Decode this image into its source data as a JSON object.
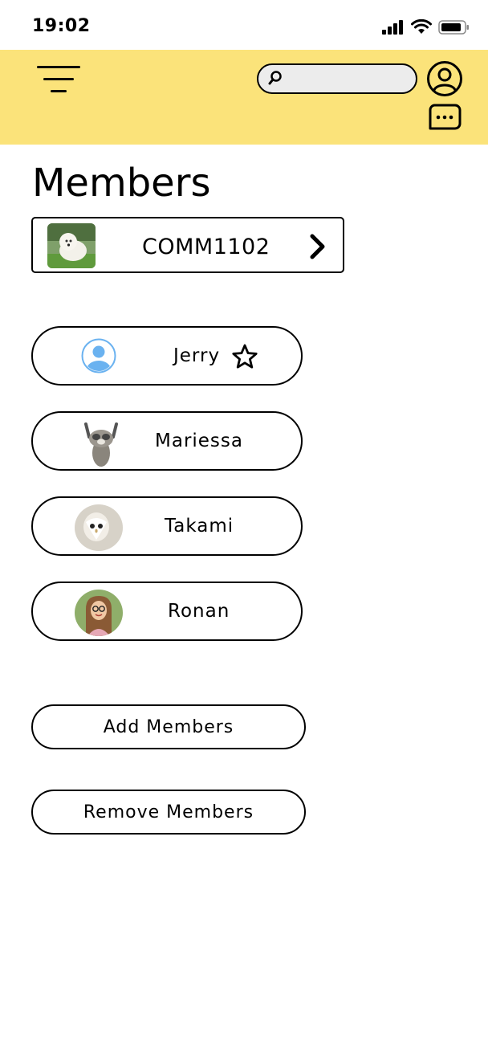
{
  "status_bar": {
    "time": "19:02",
    "icons": [
      "signal-icon",
      "wifi-icon",
      "battery-icon"
    ]
  },
  "header": {
    "background": "#fbe37a",
    "menu_icon": "hamburger-menu-icon",
    "search": {
      "placeholder": "",
      "value": ""
    },
    "profile_icon": "user-circle-icon",
    "chat_icon": "chat-bubble-icon"
  },
  "page": {
    "title": "Members"
  },
  "group": {
    "name": "COMM1102",
    "chevron": "chevron-right-icon"
  },
  "members": [
    {
      "name": "Jerry",
      "starred": true
    },
    {
      "name": "Mariessa"
    },
    {
      "name": "Takami"
    },
    {
      "name": "Ronan"
    }
  ],
  "actions": {
    "add_label": "Add Members",
    "remove_label": "Remove Members"
  }
}
